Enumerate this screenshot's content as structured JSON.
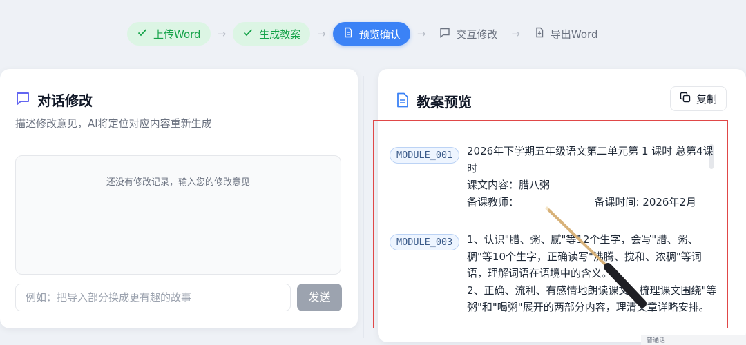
{
  "stepper": {
    "steps": [
      {
        "label": "上传Word",
        "state": "done"
      },
      {
        "label": "生成教案",
        "state": "done"
      },
      {
        "label": "预览确认",
        "state": "active"
      },
      {
        "label": "交互修改",
        "state": "todo"
      },
      {
        "label": "导出Word",
        "state": "todo"
      }
    ]
  },
  "chat_panel": {
    "title": "对话修改",
    "subtitle": "描述修改意见，AI将定位对应内容重新生成",
    "empty_history": "还没有修改记录，输入您的修改意见",
    "input_placeholder": "例如：把导入部分换成更有趣的故事",
    "send_label": "发送"
  },
  "preview_panel": {
    "title": "教案预览",
    "copy_label": "复制",
    "modules": [
      {
        "id": "MODULE_001",
        "lines": [
          "2026年下学期五年级语文第二单元第 1 课时 总第4课时",
          "课文内容：腊八粥"
        ],
        "teacher_label": "备课教师：",
        "time_label": "备课时间:  2026年2月"
      },
      {
        "id": "MODULE_003",
        "lines": [
          "1、认识\"腊、粥、腻\"等12个生字，会写\"腊、粥、稠\"等10个生字，正确读写\"沸腾、搅和、浓稠\"等词语，理解词语在语境中的含义。",
          "2、正确、流利、有感情地朗读课文。梳理课文围绕\"等粥\"和\"喝粥\"展开的两部分内容，理清文章详略安排。"
        ]
      }
    ]
  },
  "taskbar": {
    "ime_label": "普通话"
  },
  "colors": {
    "accent": "#3b82f6",
    "done_bg": "#dcf5e4",
    "done_text": "#16a34a",
    "highlight_border": "#e04848"
  }
}
